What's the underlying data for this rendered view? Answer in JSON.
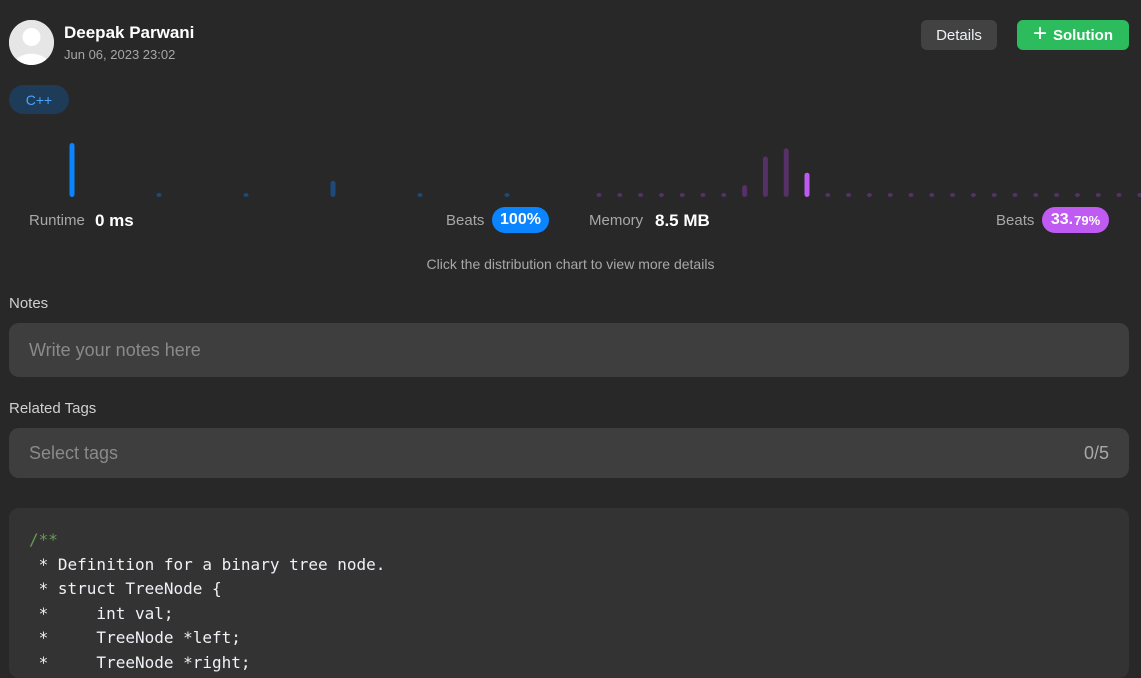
{
  "user": {
    "name": "Deepak Parwani",
    "date": "Jun 06, 2023 23:02"
  },
  "buttons": {
    "details": "Details",
    "solution": "Solution"
  },
  "language": "C++",
  "stats": {
    "runtime_label": "Runtime",
    "runtime_value": "0 ms",
    "runtime_beats_label": "Beats",
    "runtime_beats": "100%",
    "memory_label": "Memory",
    "memory_value": "8.5 MB",
    "memory_beats_label": "Beats",
    "memory_beats_main": "33.",
    "memory_beats_small": "79%"
  },
  "colors": {
    "runtime_accent": "#0a84ff",
    "memory_accent": "#bf5af2",
    "solution_green": "#2cbb5d"
  },
  "chart_data": [
    {
      "type": "bar",
      "name": "runtime-distribution",
      "values": [
        100,
        4,
        4,
        30,
        4,
        4
      ],
      "highlight_index": 0,
      "ylim": [
        0,
        100
      ]
    },
    {
      "type": "bar",
      "name": "memory-distribution",
      "values": [
        2,
        2,
        2,
        2,
        2,
        2,
        2,
        22,
        75,
        90,
        45,
        2,
        2,
        2,
        2,
        2,
        2,
        2,
        2,
        2,
        2,
        2,
        2,
        2,
        2,
        2,
        2
      ],
      "highlight_index": 10,
      "ylim": [
        0,
        100
      ]
    }
  ],
  "hint": "Click the distribution chart to view more details",
  "notes": {
    "label": "Notes",
    "placeholder": "Write your notes here"
  },
  "tags": {
    "label": "Related Tags",
    "placeholder": "Select tags",
    "count": "0/5"
  },
  "code": {
    "lines": [
      "/**",
      " * Definition for a binary tree node.",
      " * struct TreeNode {",
      " *     int val;",
      " *     TreeNode *left;",
      " *     TreeNode *right;"
    ]
  },
  "icons": {
    "avatar": "user-avatar-icon",
    "plus": "plus-icon"
  }
}
